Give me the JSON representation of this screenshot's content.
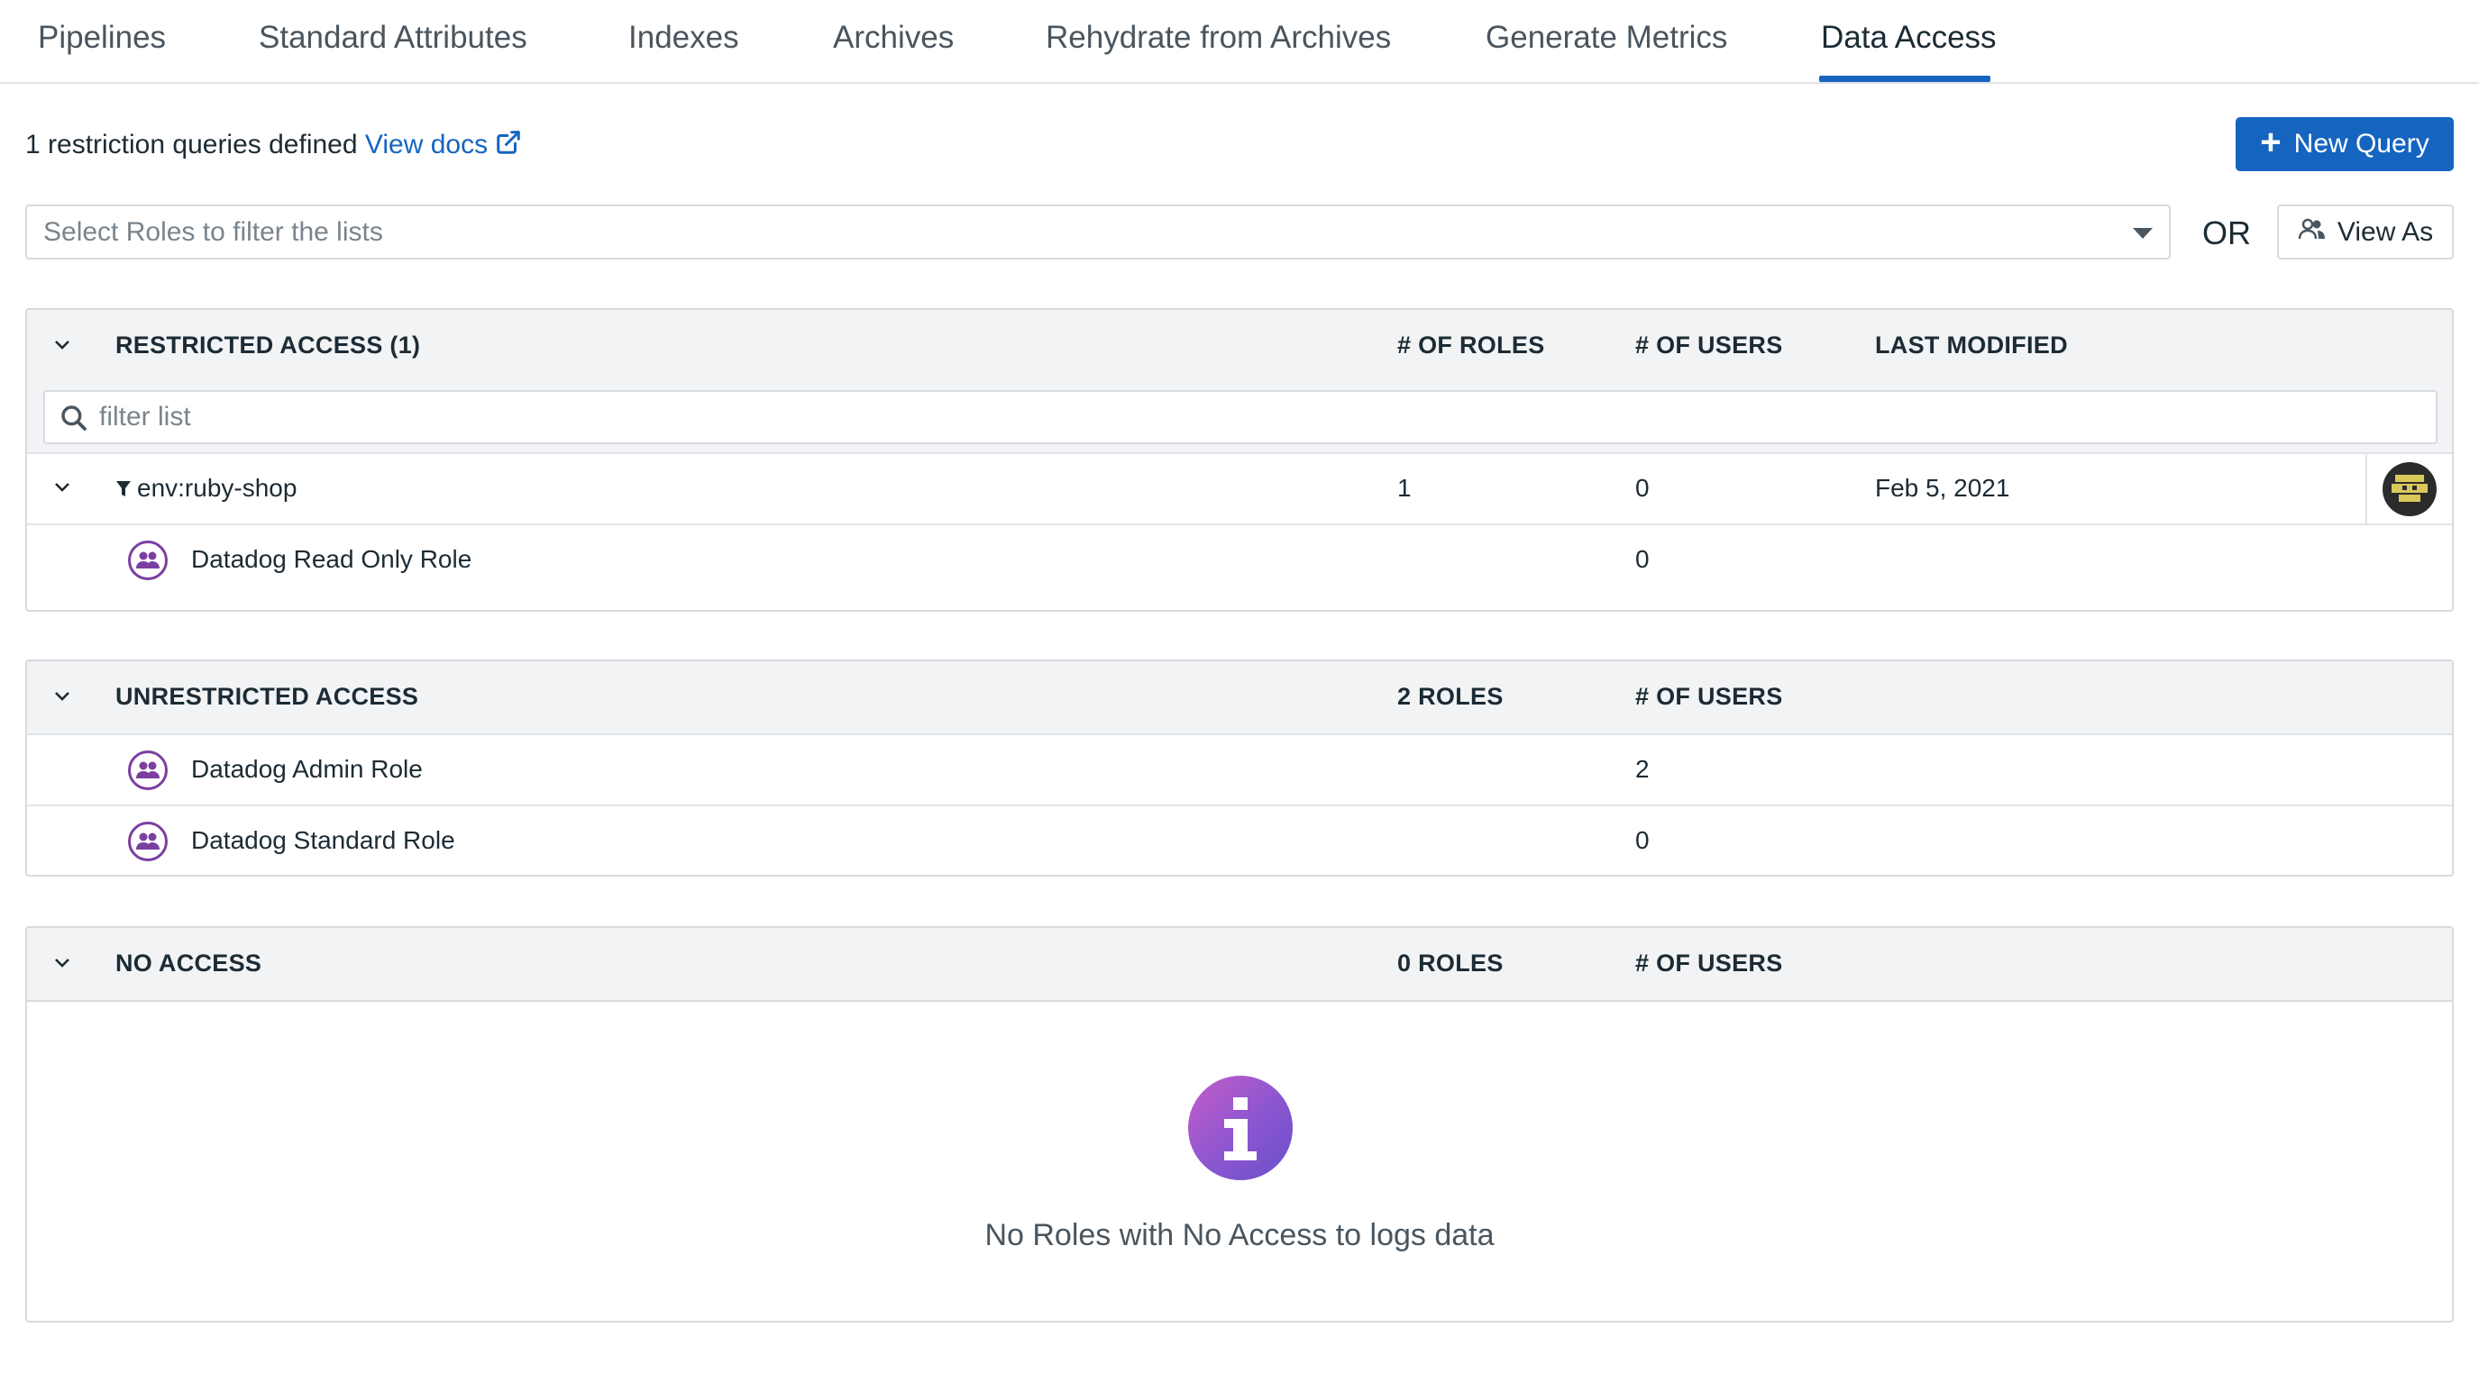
{
  "tabs": [
    {
      "label": "Pipelines"
    },
    {
      "label": "Standard Attributes"
    },
    {
      "label": "Indexes"
    },
    {
      "label": "Archives"
    },
    {
      "label": "Rehydrate from Archives"
    },
    {
      "label": "Generate Metrics"
    },
    {
      "label": "Data Access"
    }
  ],
  "active_tab": "Data Access",
  "summary": {
    "text": "1 restriction queries defined",
    "docs_link": "View docs"
  },
  "actions": {
    "new_query": "New Query",
    "view_as": "View As",
    "or": "OR"
  },
  "role_filter": {
    "placeholder": "Select Roles to filter the lists"
  },
  "restricted": {
    "title": "RESTRICTED ACCESS (1)",
    "col_roles": "# OF ROLES",
    "col_users": "# OF USERS",
    "col_modified": "LAST MODIFIED",
    "filter_placeholder": "filter list",
    "query": {
      "name": "env:ruby-shop",
      "roles": "1",
      "users": "0",
      "modified": "Feb 5, 2021"
    },
    "roles": [
      {
        "name": "Datadog Read Only Role",
        "users": "0"
      }
    ]
  },
  "unrestricted": {
    "title": "UNRESTRICTED ACCESS",
    "col_roles": "2 ROLES",
    "col_users": "# OF USERS",
    "roles": [
      {
        "name": "Datadog Admin Role",
        "users": "2"
      },
      {
        "name": "Datadog Standard Role",
        "users": "0"
      }
    ]
  },
  "no_access": {
    "title": "NO ACCESS",
    "col_roles": "0 ROLES",
    "col_users": "# OF USERS",
    "empty_message": "No Roles with No Access to logs data"
  },
  "colors": {
    "accent": "#1565c0",
    "role_icon": "#7b3fa0",
    "header_bg": "#f2f3f5"
  }
}
